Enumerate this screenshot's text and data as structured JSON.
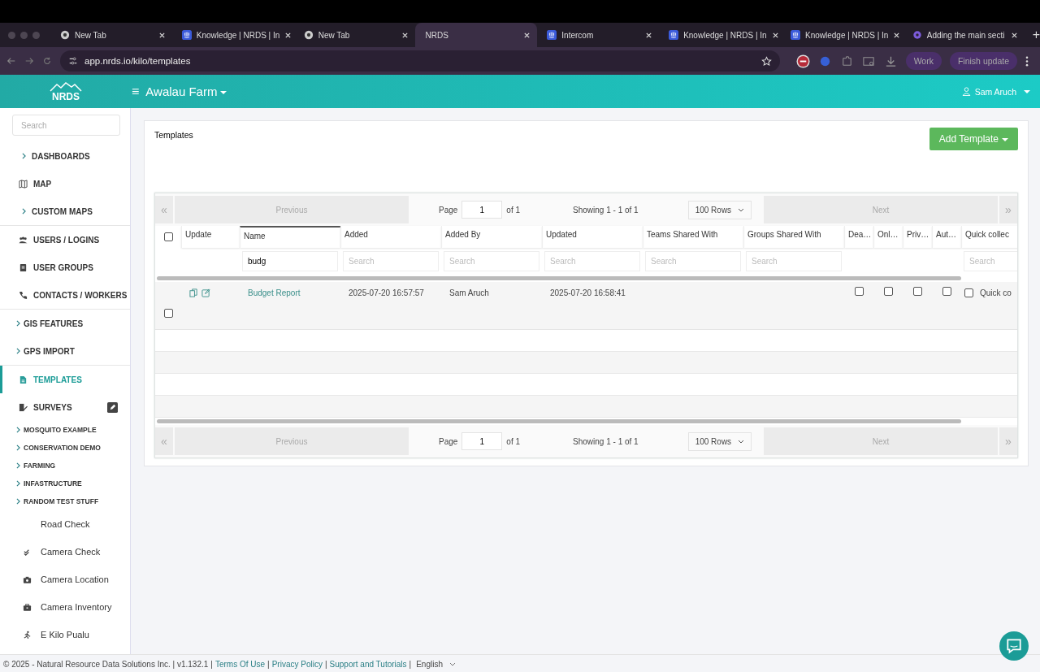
{
  "browser": {
    "tabs": [
      {
        "title": "New Tab",
        "selected": false
      },
      {
        "title": "Knowledge | NRDS | In",
        "selected": false
      },
      {
        "title": "New Tab",
        "selected": false
      },
      {
        "title": "NRDS",
        "selected": true
      },
      {
        "title": "Intercom",
        "selected": false
      },
      {
        "title": "Knowledge | NRDS | In",
        "selected": false
      },
      {
        "title": "Knowledge | NRDS | In",
        "selected": false
      },
      {
        "title": "Adding the main secti",
        "selected": false
      }
    ],
    "new_tab": "+",
    "url": "app.nrds.io/kilo/templates",
    "profile_button": "Work",
    "update_button": "Finish update"
  },
  "header": {
    "logo": "NRDS",
    "menu": "≡",
    "farm": "Awalau Farm",
    "user": "Sam Aruch"
  },
  "sidebar": {
    "search": {
      "placeholder": "Search"
    },
    "sections": [
      {
        "items": [
          {
            "label": "DASHBOARDS",
            "kind": "group",
            "selected": false
          },
          {
            "label": "MAP",
            "kind": "link",
            "selected": false
          },
          {
            "label": "CUSTOM MAPS",
            "kind": "group",
            "selected": false
          }
        ]
      },
      {
        "items": [
          {
            "label": "USERS / LOGINS",
            "kind": "link",
            "selected": false
          },
          {
            "label": "USER GROUPS",
            "kind": "link",
            "selected": false
          },
          {
            "label": "CONTACTS / WORKERS",
            "kind": "link",
            "selected": false
          }
        ]
      },
      {
        "items": [
          {
            "label": "GIS FEATURES",
            "kind": "folder",
            "selected": false
          },
          {
            "label": "GPS IMPORT",
            "kind": "folder",
            "selected": false
          }
        ]
      },
      {
        "items": [
          {
            "label": "TEMPLATES",
            "kind": "link",
            "selected": true
          },
          {
            "label": "SURVEYS",
            "kind": "editable",
            "selected": false
          },
          {
            "label": "MOSQUITO EXAMPLE",
            "kind": "sub",
            "selected": false
          },
          {
            "label": "CONSERVATION DEMO",
            "kind": "sub",
            "selected": false
          },
          {
            "label": "FARMING",
            "kind": "sub",
            "selected": false
          },
          {
            "label": "INFASTRUCTURE",
            "kind": "sub",
            "selected": false
          },
          {
            "label": "RANDOM TEST STUFF",
            "kind": "sub",
            "selected": false
          },
          {
            "label": "Road Check",
            "kind": "survey",
            "selected": false
          },
          {
            "label": "Camera Check",
            "kind": "survey",
            "selected": false
          },
          {
            "label": "Camera Location",
            "kind": "survey",
            "selected": false
          },
          {
            "label": "Camera Inventory",
            "kind": "survey",
            "selected": false
          },
          {
            "label": "E Kilo Pualu",
            "kind": "survey",
            "selected": false
          }
        ]
      }
    ]
  },
  "page": {
    "title": "Templates",
    "add_button": "Add Template"
  },
  "pagers": [
    {
      "first": "«",
      "previous": "Previous",
      "page_label": "Page",
      "page": "1",
      "of": "of 1",
      "showing": "Showing 1 - 1 of 1",
      "rows": "100 Rows",
      "next": "Next",
      "last": "»"
    },
    {
      "first": "«",
      "previous": "Previous",
      "page_label": "Page",
      "page": "1",
      "of": "of 1",
      "showing": "Showing 1 - 1 of 1",
      "rows": "100 Rows",
      "next": "Next",
      "last": "»"
    }
  ],
  "table": {
    "select_all": {
      "checked": false
    },
    "columns": [
      {
        "label": "Update",
        "sorted": false
      },
      {
        "label": "Name",
        "value": "budg",
        "sorted": true
      },
      {
        "label": "Added",
        "placeholder": "Search",
        "sorted": false
      },
      {
        "label": "Added By",
        "placeholder": "Search",
        "sorted": false
      },
      {
        "label": "Updated",
        "placeholder": "Search",
        "sorted": false
      },
      {
        "label": "Teams Shared With",
        "placeholder": "Search",
        "sorted": false
      },
      {
        "label": "Groups Shared With",
        "placeholder": "Search",
        "sorted": false
      },
      {
        "label": "Dea…",
        "sorted": false
      },
      {
        "label": "Onl…",
        "sorted": false
      },
      {
        "label": "Priv…",
        "sorted": false
      },
      {
        "label": "Aut…",
        "sorted": false
      },
      {
        "label": "Quick collec",
        "placeholder": "Search",
        "sorted": false
      }
    ],
    "rows": [
      {
        "checked": false,
        "name": "Budget Report",
        "added": "2025-07-20 16:57:57",
        "added_by": "Sam Aruch",
        "updated": "2025-07-20 16:58:41",
        "flags": [
          {
            "checked": false
          },
          {
            "checked": false
          },
          {
            "checked": false
          },
          {
            "checked": false
          }
        ],
        "quick": {
          "checked": false,
          "label": "Quick co"
        }
      }
    ]
  },
  "footer": {
    "parts": [
      {
        "kind": "text",
        "text": "© 2025 - Natural Resource Data Solutions Inc. | v1.132.1"
      },
      {
        "kind": "separator",
        "text": "|"
      },
      {
        "kind": "link",
        "text": "Terms Of Use"
      },
      {
        "kind": "separator",
        "text": "|"
      },
      {
        "kind": "link",
        "text": "Privacy Policy"
      },
      {
        "kind": "separator",
        "text": "|"
      },
      {
        "kind": "link",
        "text": "Support and Tutorials"
      },
      {
        "kind": "separator",
        "text": "|"
      },
      {
        "kind": "language",
        "text": "English"
      }
    ]
  }
}
